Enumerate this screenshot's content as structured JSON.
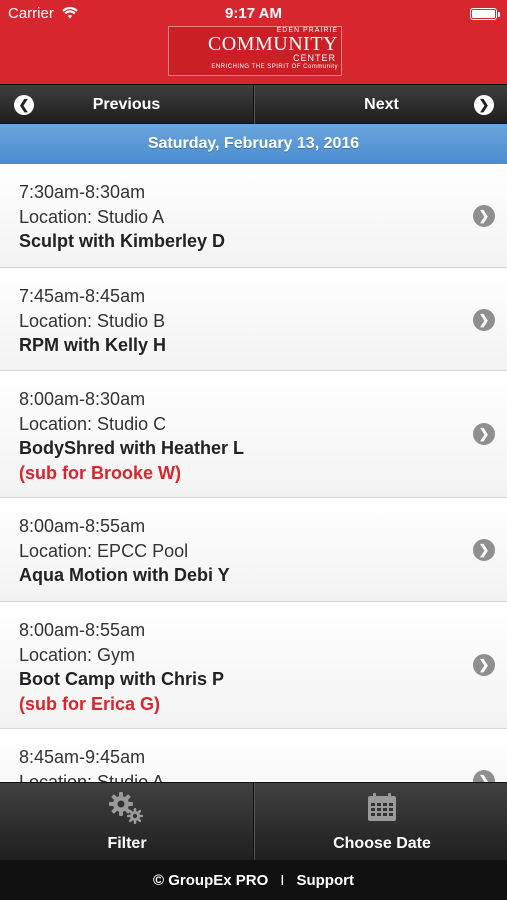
{
  "status_bar": {
    "carrier": "Carrier",
    "time": "9:17 AM"
  },
  "logo": {
    "line1": "EDEN PRAIRIE",
    "line2": "COMMUNITY",
    "line3": "CENTER",
    "line4": "ENRICHING THE SPIRIT OF Community"
  },
  "nav": {
    "previous_label": "Previous",
    "next_label": "Next"
  },
  "date_header": "Saturday, February 13, 2016",
  "classes": [
    {
      "time": "7:30am-8:30am",
      "location": "Location: Studio A",
      "name": "Sculpt with Kimberley D",
      "sub": ""
    },
    {
      "time": "7:45am-8:45am",
      "location": "Location: Studio B",
      "name": "RPM with Kelly H",
      "sub": ""
    },
    {
      "time": "8:00am-8:30am",
      "location": "Location: Studio C",
      "name": "BodyShred with Heather L",
      "sub": "(sub for Brooke W)"
    },
    {
      "time": "8:00am-8:55am",
      "location": "Location: EPCC Pool",
      "name": "Aqua Motion with Debi Y",
      "sub": ""
    },
    {
      "time": "8:00am-8:55am",
      "location": "Location: Gym",
      "name": "Boot Camp with Chris P",
      "sub": "(sub for Erica G)"
    },
    {
      "time": "8:45am-9:45am",
      "location": "Location: Studio A",
      "name": "",
      "sub": ""
    }
  ],
  "toolbar": {
    "filter_label": "Filter",
    "choose_date_label": "Choose Date"
  },
  "footer": {
    "copyright": "© GroupEx PRO",
    "separator": "I",
    "support": "Support"
  },
  "colors": {
    "header_red": "#d7262d",
    "date_blue": "#4a8ccf",
    "sub_red": "#d7262d"
  }
}
